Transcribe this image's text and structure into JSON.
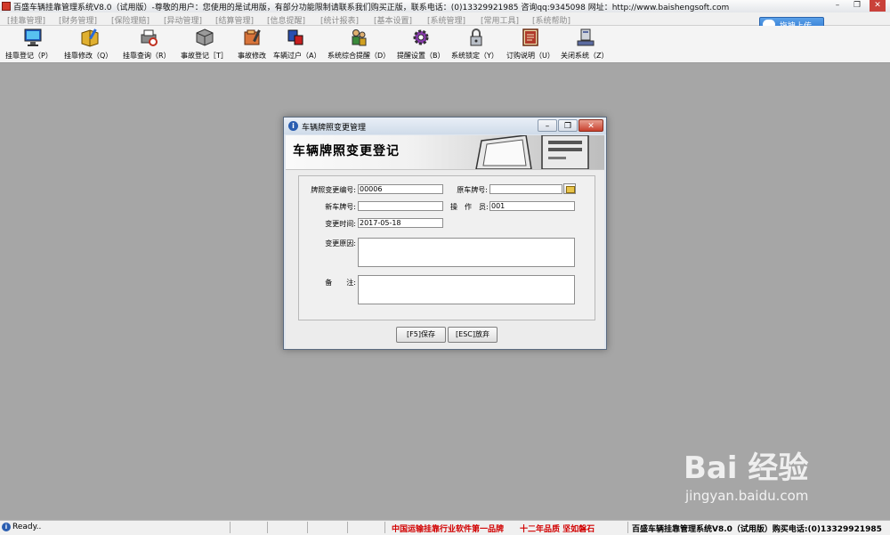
{
  "window": {
    "title": "百盛车辆挂靠管理系统V8.0（试用版）-尊敬的用户：您使用的是试用版，有部分功能限制请联系我们购买正版，联系电话：(0)13329921985  咨询qq:9345098  网址：http://www.baishengsoft.com",
    "minimize": "–",
    "restore": "❐",
    "close": "✕"
  },
  "menu": [
    "[挂靠管理]",
    "[财务管理]",
    "[保险理赔]",
    "[异动管理]",
    "[结算管理]",
    "[信息提醒]",
    "[统计报表]",
    "[基本设置]",
    "[系统管理]",
    "[常用工具]",
    "[系统帮助]"
  ],
  "upload_button": "拖拽上传",
  "toolbar": [
    {
      "label": "挂靠登记（P）",
      "icon": "monitor-icon",
      "color": "#2a7ad8"
    },
    {
      "label": "挂靠修改（Q）",
      "icon": "book-edit-icon",
      "color": "#d9a020"
    },
    {
      "label": "挂靠查询（R）",
      "icon": "printer-search-icon",
      "color": "#6d6d6d"
    },
    {
      "label": "事故登记［T］",
      "icon": "cube-icon",
      "color": "#7a7a7a"
    },
    {
      "label": "事故修改",
      "icon": "folder-edit-icon",
      "color": "#c8642a"
    },
    {
      "label": "车辆过户（A）",
      "icon": "transfer-icon",
      "color": "#2a4fb0"
    },
    {
      "label": "系统综合提醒（D）",
      "icon": "people-icon",
      "color": "#3a8a3a"
    },
    {
      "label": "提醒设置（B）",
      "icon": "gear-icon",
      "color": "#8a3ab0"
    },
    {
      "label": "系统锁定（Y）",
      "icon": "lock-icon",
      "color": "#9aa0a8"
    },
    {
      "label": "订购说明（U）",
      "icon": "document-icon",
      "color": "#b03a2a"
    },
    {
      "label": "关闭系统（Z）",
      "icon": "computer-icon",
      "color": "#5a6aa0"
    }
  ],
  "dialog": {
    "title": "车辆牌照变更管理",
    "banner_title": "车辆牌照变更登记",
    "fields": {
      "change_no_label": "牌照变更编号:",
      "change_no_value": "00006",
      "old_plate_label": "原车牌号:",
      "old_plate_value": "",
      "new_plate_label": "新车牌号:",
      "new_plate_value": "",
      "operator_label": "操　作　员:",
      "operator_value": "001",
      "change_time_label": "变更时间:",
      "change_time_value": "2017-05-18",
      "reason_label": "变更原因:",
      "remark_label": "备　　注:"
    },
    "save_button": "[F5]保存",
    "discard_button": "[ESC]放弃"
  },
  "status": {
    "ready": "Ready..",
    "slogan": "中国运输挂靠行业软件第一品牌　　十二年品质 坚如磐石",
    "product": "百盛车辆挂靠管理系统V8.0（试用版）购买电话:(0)13329921985"
  },
  "watermark": {
    "brand": "Bai 经验",
    "url": "jingyan.baidu.com"
  }
}
